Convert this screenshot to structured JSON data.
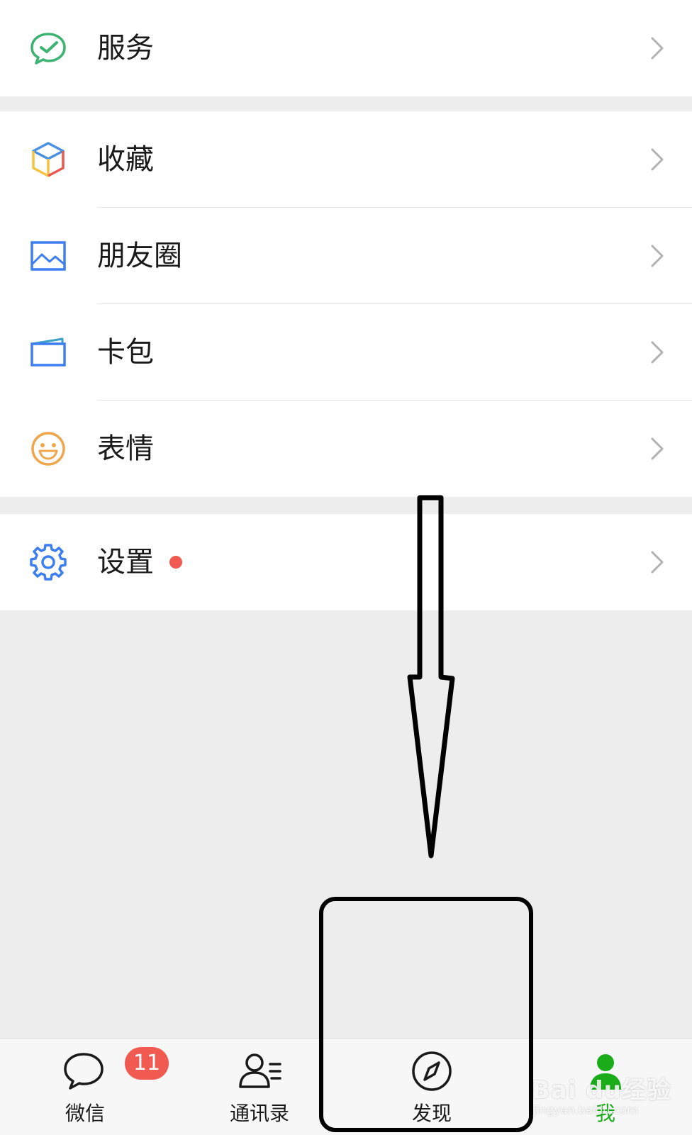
{
  "groups": [
    {
      "items": [
        {
          "label": "服务",
          "icon": "wechat-pay-check-icon"
        }
      ]
    },
    {
      "items": [
        {
          "label": "收藏",
          "icon": "favorites-cube-icon"
        },
        {
          "label": "朋友圈",
          "icon": "moments-image-icon"
        },
        {
          "label": "卡包",
          "icon": "card-wallet-icon"
        },
        {
          "label": "表情",
          "icon": "smiley-face-icon"
        }
      ]
    },
    {
      "items": [
        {
          "label": "设置",
          "icon": "gear-icon",
          "has_red_dot": true
        }
      ]
    }
  ],
  "tabbar": {
    "tabs": [
      {
        "label": "微信",
        "icon": "chat-bubble-icon",
        "badge": "11"
      },
      {
        "label": "通讯录",
        "icon": "contacts-icon"
      },
      {
        "label": "发现",
        "icon": "compass-icon"
      },
      {
        "label": "我",
        "icon": "person-icon",
        "active": true
      }
    ]
  },
  "watermark": {
    "text": "Bai du经验",
    "sub": "jingyan.baidu.com"
  },
  "colors": {
    "wechat_green": "#1aad19",
    "badge_red": "#f05a50",
    "background": "#ededed",
    "row_background": "#ffffff",
    "tabbar_background": "#f7f7f7"
  }
}
